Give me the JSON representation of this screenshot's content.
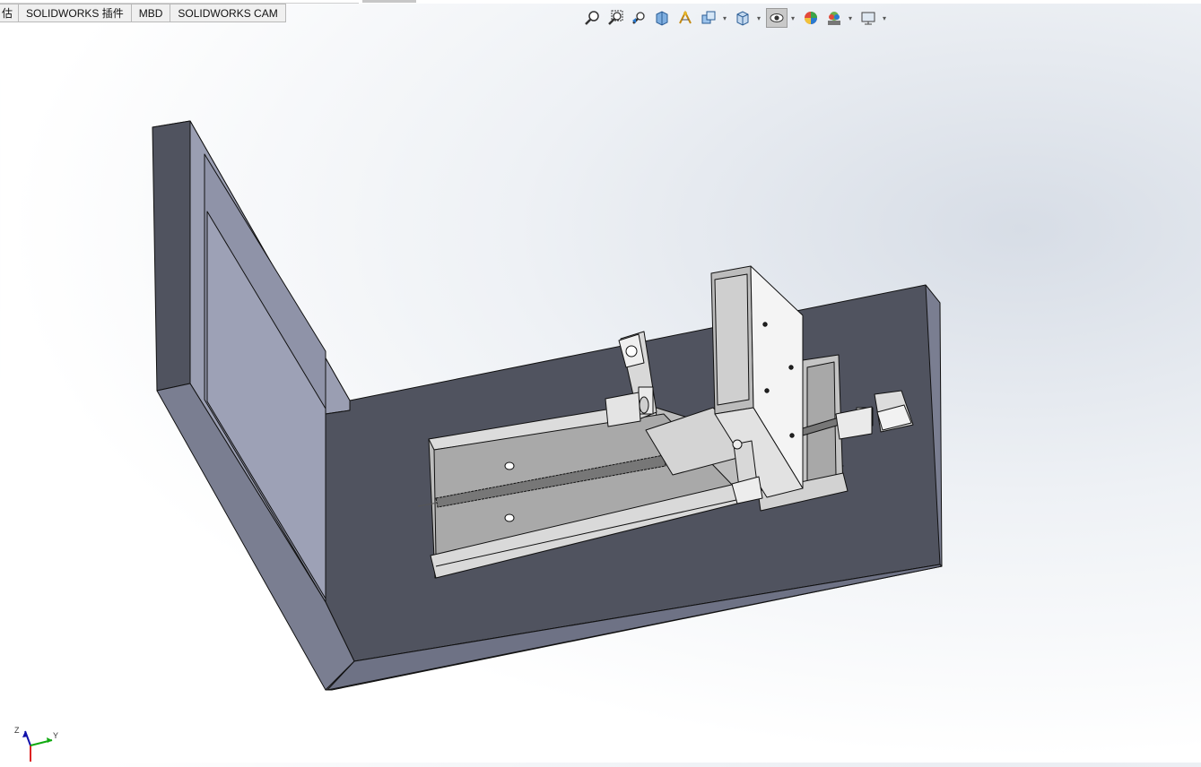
{
  "tabs": [
    {
      "label": "估"
    },
    {
      "label": "SOLIDWORKS 插件"
    },
    {
      "label": "MBD"
    },
    {
      "label": "SOLIDWORKS CAM"
    }
  ],
  "hud_toolbar": [
    {
      "icon": "zoom-to-fit-icon"
    },
    {
      "icon": "zoom-to-area-icon"
    },
    {
      "icon": "previous-view-icon"
    },
    {
      "icon": "section-view-icon"
    },
    {
      "icon": "dynamic-annotation-icon"
    },
    {
      "icon": "view-orientation-icon"
    },
    {
      "icon": "display-style-icon"
    },
    {
      "icon": "hide-show-items-icon",
      "active": true
    },
    {
      "icon": "edit-appearance-icon"
    },
    {
      "icon": "apply-scene-icon"
    },
    {
      "icon": "view-settings-icon"
    }
  ],
  "triad": {
    "z": "Z",
    "y": "Y"
  },
  "colors": {
    "base_top": "#50535f",
    "base_side": "#7a7e91",
    "wall_face": "#9a9eb2",
    "metal": "#c9c9c9"
  }
}
